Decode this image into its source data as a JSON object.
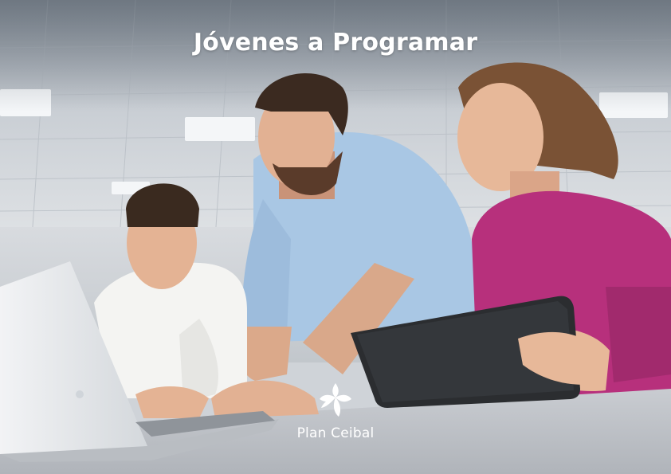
{
  "cover": {
    "title": "Jóvenes a Programar",
    "brand_name": "Plan Ceibal"
  },
  "icons": {
    "brand_logo": "plan-ceibal-logo-icon"
  },
  "colors": {
    "title_text": "#ffffff",
    "left_shirt": "#f4f4f2",
    "center_shirt": "#a9c7e4",
    "right_sweater": "#b7307c",
    "tablet": "#2b2d30"
  }
}
